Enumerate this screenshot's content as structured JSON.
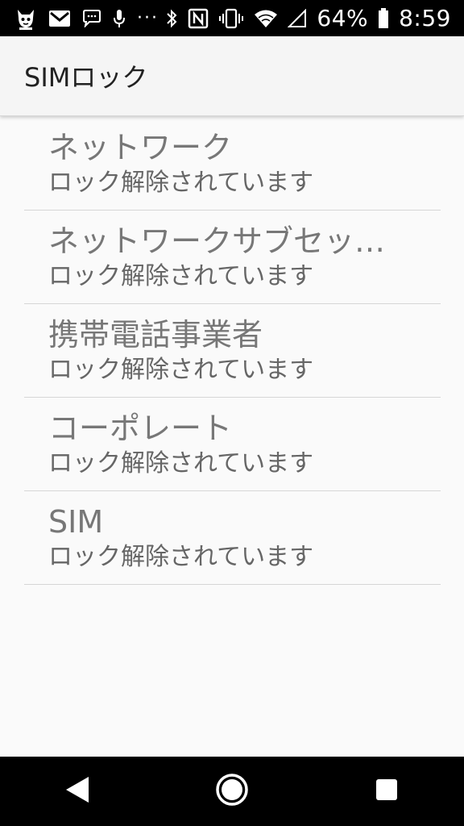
{
  "status_bar": {
    "battery_percent": "64%",
    "time": "8:59",
    "icons_left": [
      "app-mascot-icon",
      "gmail-icon",
      "messages-icon",
      "voice-icon",
      "more-notifications-icon"
    ],
    "icons_right": [
      "bluetooth-icon",
      "nfc-icon",
      "vibrate-icon",
      "wifi-icon",
      "cell-signal-icon",
      "battery-icon"
    ]
  },
  "app_bar": {
    "title": "SIMロック"
  },
  "lock_list": [
    {
      "title": "ネットワーク",
      "summary": "ロック解除されています"
    },
    {
      "title": "ネットワークサブセッ…",
      "summary": "ロック解除されています"
    },
    {
      "title": "携帯電話事業者",
      "summary": "ロック解除されています"
    },
    {
      "title": "コーポレート",
      "summary": "ロック解除されています"
    },
    {
      "title": "SIM",
      "summary": "ロック解除されています"
    }
  ],
  "nav_bar": {
    "buttons": [
      "back-icon",
      "home-icon",
      "recents-icon"
    ]
  },
  "colors": {
    "status_bar_bg": "#000000",
    "app_bar_bg": "#f5f5f5",
    "page_bg": "#fafafa",
    "item_text": "#777777"
  }
}
